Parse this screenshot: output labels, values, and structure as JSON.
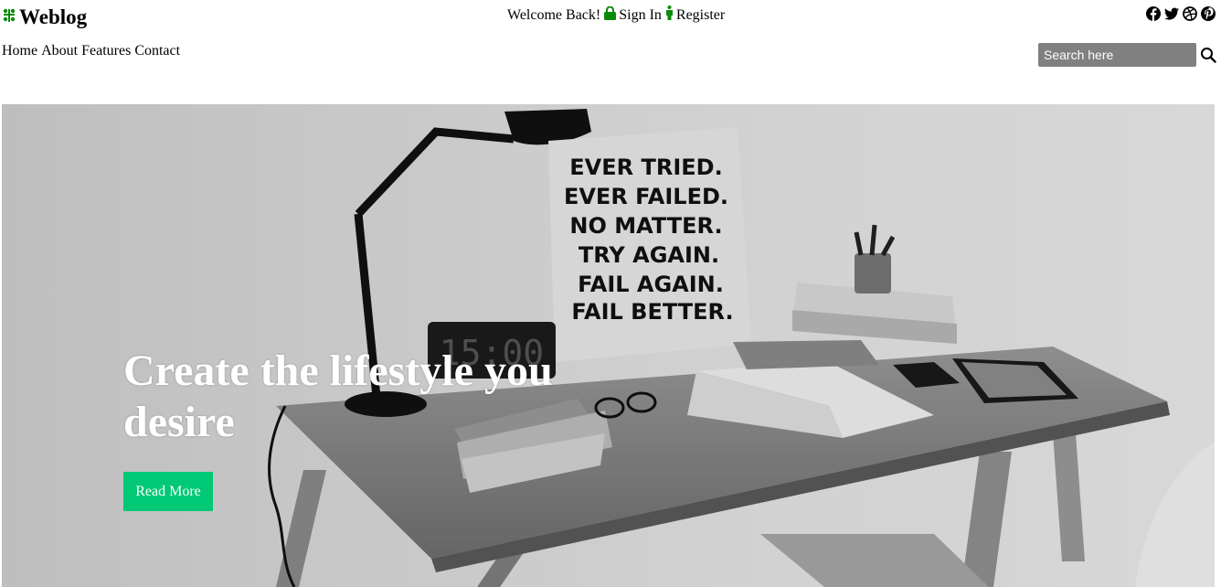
{
  "header": {
    "logo_text": "Weblog",
    "welcome_text": "Welcome Back!",
    "sign_in_label": "Sign In",
    "register_label": "Register",
    "social_icons": [
      "facebook-icon",
      "twitter-icon",
      "dribbble-icon",
      "pinterest-icon"
    ]
  },
  "nav": {
    "items": [
      "Home",
      "About",
      "Features",
      "Contact"
    ]
  },
  "search": {
    "placeholder": "Search here"
  },
  "hero": {
    "title": "Create the lifestyle you desire",
    "button_label": "Read More",
    "poster_lines": [
      "EVER TRIED.",
      "EVER FAILED.",
      "NO MATTER.",
      "TRY AGAIN.",
      "FAIL AGAIN.",
      "FAIL BETTER."
    ],
    "clock_text": "15:00"
  },
  "colors": {
    "accent": "#00c875",
    "icon_green": "#0a8a0a",
    "search_bg": "#808080"
  }
}
